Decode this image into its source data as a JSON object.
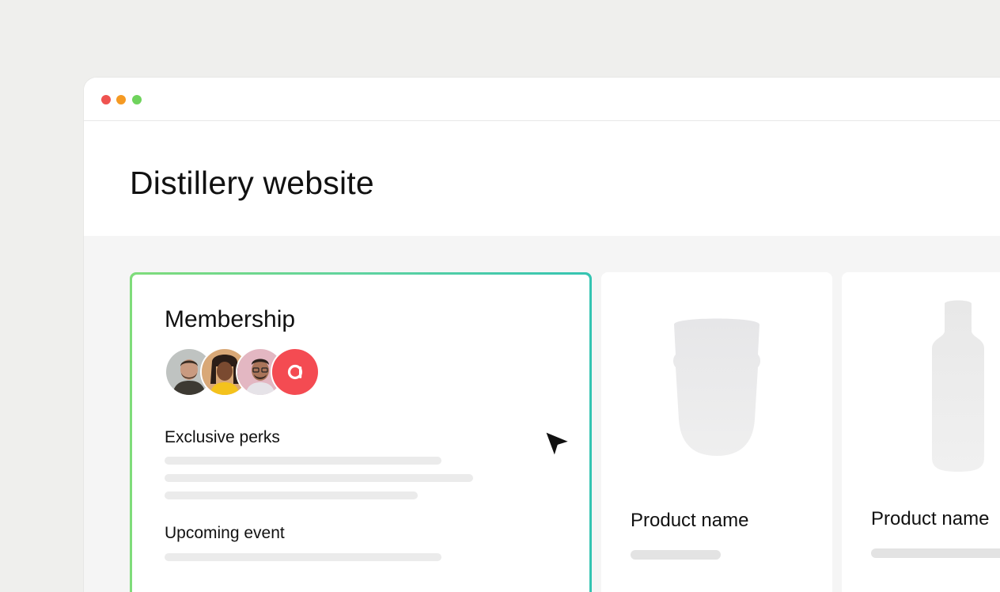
{
  "window": {
    "traffic_lights": {
      "close_color": "#ef5350",
      "minimize_color": "#f59a23",
      "maximize_color": "#6fd35c"
    }
  },
  "header": {
    "title": "Distillery website"
  },
  "membership_card": {
    "title": "Membership",
    "border_gradient": [
      "#7fdc7a",
      "#35c4b2"
    ],
    "avatars": [
      {
        "name": "avatar-man-beard",
        "bg": "#bfc3c1"
      },
      {
        "name": "avatar-woman-braids",
        "bg": "#d9a877"
      },
      {
        "name": "avatar-man-glasses",
        "bg": "#e3b7c2"
      },
      {
        "name": "avatar-brand-logo",
        "bg": "#f44b52"
      }
    ],
    "sections": [
      {
        "label": "Exclusive perks"
      },
      {
        "label": "Upcoming event"
      }
    ]
  },
  "products": [
    {
      "name": "Product name",
      "image": "glass-tumbler-icon"
    },
    {
      "name": "Product name",
      "image": "bottle-icon"
    }
  ]
}
